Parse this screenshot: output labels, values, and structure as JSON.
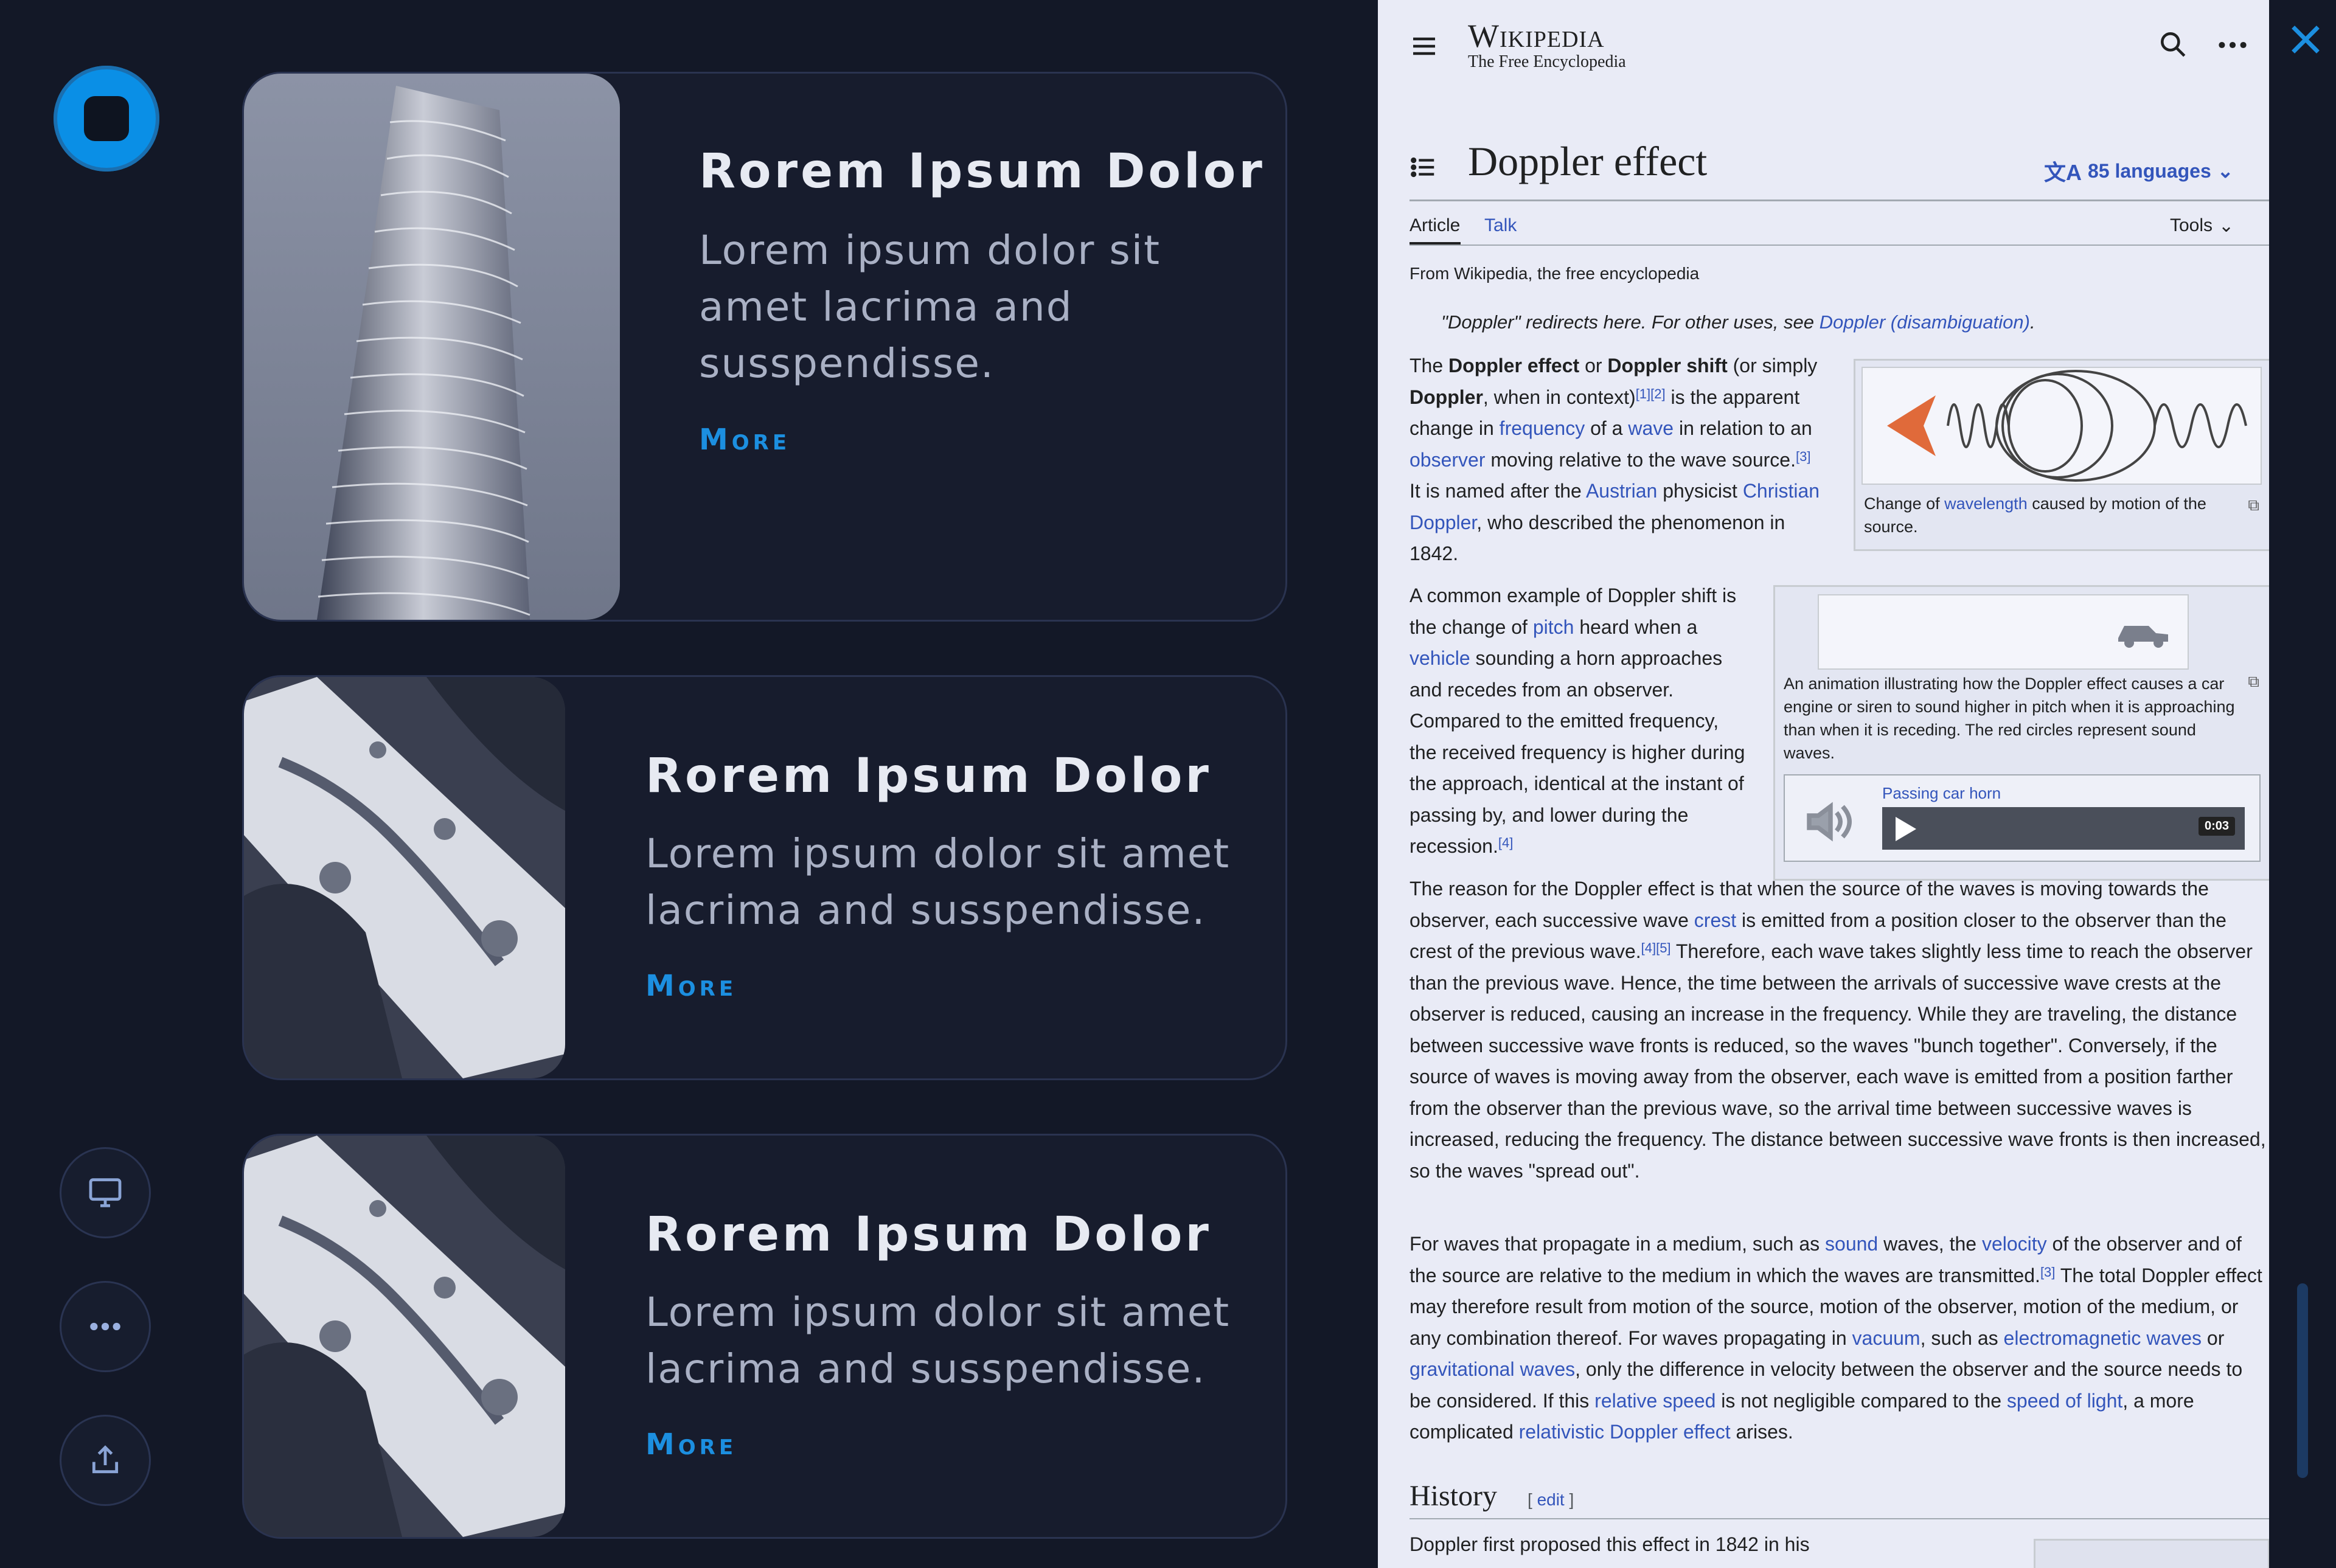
{
  "app": {
    "record_label": "record",
    "side_buttons": [
      "display",
      "more",
      "share"
    ]
  },
  "cards": [
    {
      "title": "Rorem Ipsum Dolor",
      "desc_lines": [
        "Lorem ipsum dolor sit",
        "amet lacrima and",
        "susspendisse."
      ],
      "more": "More",
      "image": "building"
    },
    {
      "title": "Rorem Ipsum Dolor",
      "desc_lines": [
        "Lorem ipsum dolor sit amet",
        "lacrima and susspendisse."
      ],
      "more": "More",
      "image": "marble"
    },
    {
      "title": "Rorem Ipsum Dolor",
      "desc_lines": [
        "Lorem ipsum dolor sit amet",
        "lacrima and susspendisse."
      ],
      "more": "More",
      "image": "marble"
    }
  ],
  "wiki": {
    "logo_main": "Wikipedia",
    "logo_sub": "The Free Encyclopedia",
    "title": "Doppler effect",
    "languages": "85 languages",
    "tabs": [
      "Article",
      "Talk"
    ],
    "tools": "Tools",
    "from": "From Wikipedia, the free encyclopedia",
    "hatnote_pre": "\"Doppler\" redirects here. For other uses, see ",
    "hatnote_link": "Doppler (disambiguation)",
    "hatnote_post": ".",
    "fig1_caption_pre": "Change of ",
    "fig1_caption_link": "wavelength",
    "fig1_caption_post": " caused by motion of the source.",
    "fig2_caption": "An animation illustrating how the Doppler effect causes a car engine or siren to sound higher in pitch when it is approaching than when it is receding. The red circles represent sound waves.",
    "audio_title": "Passing car horn",
    "audio_time": "0:03",
    "history_heading": "History",
    "edit_label": "edit",
    "history_text": "Doppler first proposed this effect in 1842 in his",
    "colors": {
      "link": "#3355bb",
      "accent": "#1c8fe0",
      "record": "#0a8fe6"
    }
  }
}
